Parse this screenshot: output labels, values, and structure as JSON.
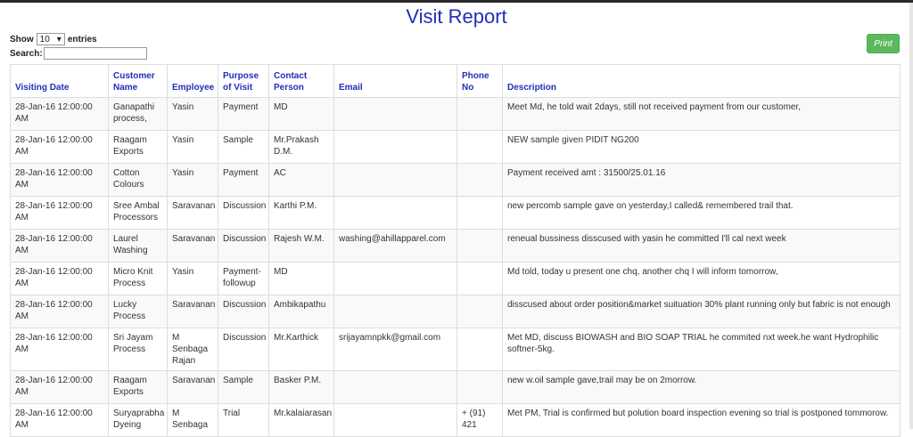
{
  "title": "Visit Report",
  "controls": {
    "show_label": "Show",
    "entries_value": "10",
    "entries_label": "entries",
    "search_label": "Search:",
    "print_label": "Print"
  },
  "headers": [
    "Visiting Date",
    "Customer Name",
    "Employee",
    "Purpose of Visit",
    "Contact Person",
    "Email",
    "Phone No",
    "Description"
  ],
  "rows": [
    [
      "28-Jan-16 12:00:00 AM",
      "Ganapathi process,",
      "Yasin",
      "Payment",
      "MD",
      "",
      "",
      "Meet Md, he told wait 2days, still not received payment from our customer,"
    ],
    [
      "28-Jan-16 12:00:00 AM",
      "Raagam Exports",
      "Yasin",
      "Sample",
      "Mr.Prakash D.M.",
      "",
      "",
      "NEW sample given PIDIT NG200"
    ],
    [
      "28-Jan-16 12:00:00 AM",
      "Cotton Colours",
      "Yasin",
      "Payment",
      "AC",
      "",
      "",
      "Payment received amt : 31500/25.01.16"
    ],
    [
      "28-Jan-16 12:00:00 AM",
      "Sree Ambal Processors",
      "Saravanan",
      "Discussion",
      "Karthi P.M.",
      "",
      "",
      "new percomb sample gave on yesterday,I called& remembered trail that."
    ],
    [
      "28-Jan-16 12:00:00 AM",
      "Laurel Washing",
      "Saravanan",
      "Discussion",
      "Rajesh W.M.",
      "washing@ahillapparel.com",
      "",
      "reneual bussiness disscused with yasin he committed I'll cal next week"
    ],
    [
      "28-Jan-16 12:00:00 AM",
      "Micro Knit Process",
      "Yasin",
      "Payment-followup",
      "MD",
      "",
      "",
      "Md told, today u present one chq, another chq I will inform tomorrow,"
    ],
    [
      "28-Jan-16 12:00:00 AM",
      "Lucky Process",
      "Saravanan",
      "Discussion",
      "Ambikapathu",
      "",
      "",
      "disscused about order position&market suituation 30% plant running only but fabric is not enough"
    ],
    [
      "28-Jan-16 12:00:00 AM",
      "Sri Jayam Process",
      "M Senbaga Rajan",
      "Discussion",
      "Mr.Karthick",
      "srijayamnpkk@gmail.com",
      "",
      "Met MD, discuss BIOWASH and BIO SOAP TRIAL he commited nxt week.he want Hydrophilic softner-5kg."
    ],
    [
      "28-Jan-16 12:00:00 AM",
      "Raagam Exports",
      "Saravanan",
      "Sample",
      "Basker P.M.",
      "",
      "",
      "new w.oil sample gave,trail may be on 2morrow."
    ],
    [
      "28-Jan-16 12:00:00 AM",
      "Suryaprabha Dyeing",
      "M Senbaga",
      "Trial",
      "Mr.kalaiarasan",
      "",
      "+ (91) 421",
      "Met PM, Trial is confirmed but polution board inspection evening so trial is postponed tommorow."
    ]
  ]
}
